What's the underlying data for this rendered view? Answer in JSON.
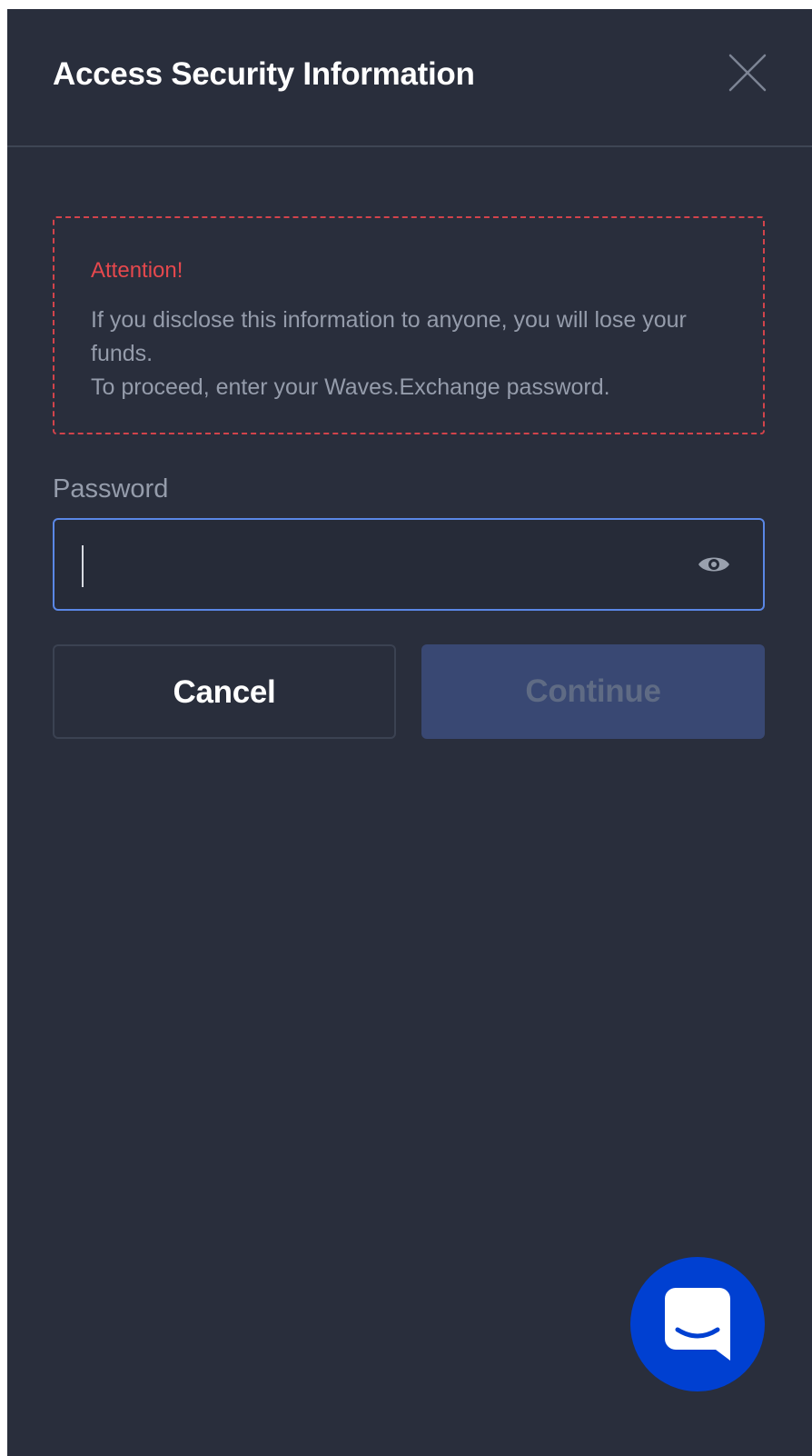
{
  "dialog": {
    "title": "Access Security Information",
    "close_icon": "close-icon"
  },
  "warning": {
    "heading": "Attention!",
    "lines": [
      "If you disclose this information to anyone, you will lose your funds.",
      "To proceed, enter your Waves.Exchange password."
    ],
    "color": "#e5484d"
  },
  "password": {
    "label": "Password",
    "value": "",
    "placeholder": "",
    "toggle_icon": "eye-icon"
  },
  "actions": {
    "cancel_label": "Cancel",
    "continue_label": "Continue",
    "continue_enabled": false
  },
  "chat": {
    "icon": "chat-bubble-icon",
    "color": "#0040d1"
  },
  "colors": {
    "background": "#292e3c",
    "focus_border": "#5a87e6",
    "primary_disabled": "#394873"
  }
}
